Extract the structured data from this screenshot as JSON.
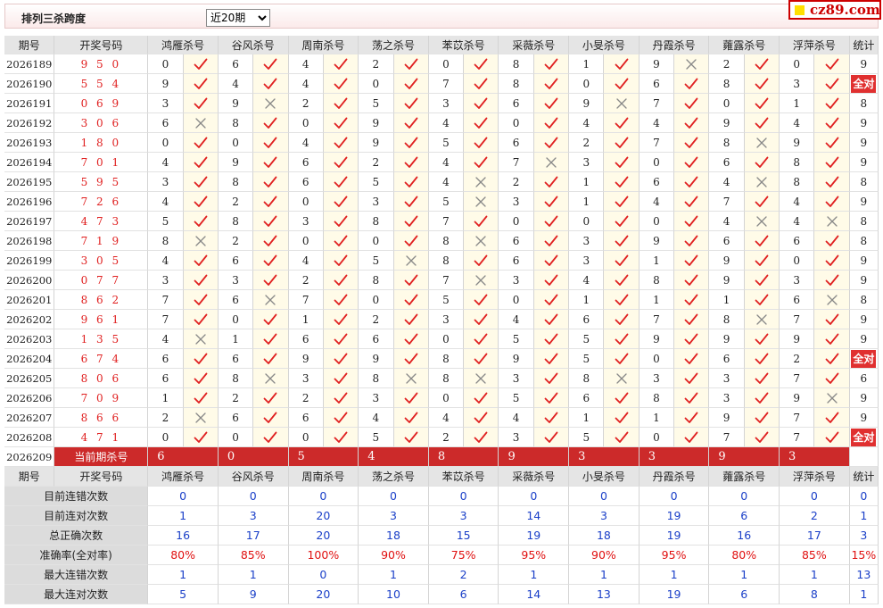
{
  "header": {
    "title": "排列三杀跨度",
    "period_select": {
      "value": "近20期",
      "options": [
        "近20期"
      ]
    },
    "logo": "cz89.com"
  },
  "columns": {
    "period": "期号",
    "win": "开奖号码",
    "experts": [
      "鸿雁杀号",
      "谷风杀号",
      "周南杀号",
      "荡之杀号",
      "苯苡杀号",
      "采薇杀号",
      "小旻杀号",
      "丹霞杀号",
      "蕹露杀号",
      "浮萍杀号"
    ],
    "stat": "统计"
  },
  "rows": [
    {
      "p": "2026189",
      "w": "9 5 0",
      "d": [
        0,
        6,
        4,
        2,
        0,
        8,
        1,
        9,
        2,
        0
      ],
      "m": [
        1,
        1,
        1,
        1,
        1,
        1,
        1,
        0,
        1,
        1
      ],
      "s": "9"
    },
    {
      "p": "2026190",
      "w": "5 5 4",
      "d": [
        9,
        4,
        4,
        0,
        7,
        8,
        0,
        6,
        8,
        3
      ],
      "m": [
        1,
        1,
        1,
        1,
        1,
        1,
        1,
        1,
        1,
        1
      ],
      "s": "全对"
    },
    {
      "p": "2026191",
      "w": "0 6 9",
      "d": [
        3,
        9,
        2,
        5,
        3,
        6,
        9,
        7,
        0,
        1
      ],
      "m": [
        1,
        0,
        1,
        1,
        1,
        1,
        0,
        1,
        1,
        1
      ],
      "s": "8"
    },
    {
      "p": "2026192",
      "w": "3 0 6",
      "d": [
        6,
        8,
        0,
        9,
        4,
        0,
        4,
        4,
        9,
        4
      ],
      "m": [
        0,
        1,
        1,
        1,
        1,
        1,
        1,
        1,
        1,
        1
      ],
      "s": "9"
    },
    {
      "p": "2026193",
      "w": "1 8 0",
      "d": [
        0,
        0,
        4,
        9,
        5,
        6,
        2,
        7,
        8,
        9
      ],
      "m": [
        1,
        1,
        1,
        1,
        1,
        1,
        1,
        1,
        0,
        1
      ],
      "s": "9"
    },
    {
      "p": "2026194",
      "w": "7 0 1",
      "d": [
        4,
        9,
        6,
        2,
        4,
        7,
        3,
        0,
        6,
        8
      ],
      "m": [
        1,
        1,
        1,
        1,
        1,
        0,
        1,
        1,
        1,
        1
      ],
      "s": "9"
    },
    {
      "p": "2026195",
      "w": "5 9 5",
      "d": [
        3,
        8,
        6,
        5,
        4,
        2,
        1,
        6,
        4,
        8
      ],
      "m": [
        1,
        1,
        1,
        1,
        0,
        1,
        1,
        1,
        0,
        1
      ],
      "s": "8"
    },
    {
      "p": "2026196",
      "w": "7 2 6",
      "d": [
        4,
        2,
        0,
        3,
        5,
        3,
        1,
        4,
        7,
        4
      ],
      "m": [
        1,
        1,
        1,
        1,
        0,
        1,
        1,
        1,
        1,
        1
      ],
      "s": "9"
    },
    {
      "p": "2026197",
      "w": "4 7 3",
      "d": [
        5,
        8,
        3,
        8,
        7,
        0,
        0,
        0,
        4,
        4
      ],
      "m": [
        1,
        1,
        1,
        1,
        1,
        1,
        1,
        1,
        0,
        0
      ],
      "s": "8"
    },
    {
      "p": "2026198",
      "w": "7 1 9",
      "d": [
        8,
        2,
        0,
        0,
        8,
        6,
        3,
        9,
        6,
        6
      ],
      "m": [
        0,
        1,
        1,
        1,
        0,
        1,
        1,
        1,
        1,
        1
      ],
      "s": "8"
    },
    {
      "p": "2026199",
      "w": "3 0 5",
      "d": [
        4,
        6,
        4,
        5,
        8,
        6,
        3,
        1,
        9,
        0
      ],
      "m": [
        1,
        1,
        1,
        0,
        1,
        1,
        1,
        1,
        1,
        1
      ],
      "s": "9"
    },
    {
      "p": "2026200",
      "w": "0 7 7",
      "d": [
        3,
        3,
        2,
        8,
        7,
        3,
        4,
        8,
        9,
        3
      ],
      "m": [
        1,
        1,
        1,
        1,
        0,
        1,
        1,
        1,
        1,
        1
      ],
      "s": "9"
    },
    {
      "p": "2026201",
      "w": "8 6 2",
      "d": [
        7,
        6,
        7,
        0,
        5,
        0,
        1,
        1,
        1,
        6
      ],
      "m": [
        1,
        0,
        1,
        1,
        1,
        1,
        1,
        1,
        1,
        0
      ],
      "s": "8"
    },
    {
      "p": "2026202",
      "w": "9 6 1",
      "d": [
        7,
        0,
        1,
        2,
        3,
        4,
        6,
        7,
        8,
        7
      ],
      "m": [
        1,
        1,
        1,
        1,
        1,
        1,
        1,
        1,
        0,
        1
      ],
      "s": "9"
    },
    {
      "p": "2026203",
      "w": "1 3 5",
      "d": [
        4,
        1,
        6,
        6,
        0,
        5,
        5,
        9,
        9,
        9
      ],
      "m": [
        0,
        1,
        1,
        1,
        1,
        1,
        1,
        1,
        1,
        1
      ],
      "s": "9"
    },
    {
      "p": "2026204",
      "w": "6 7 4",
      "d": [
        6,
        6,
        9,
        9,
        8,
        9,
        5,
        0,
        6,
        2
      ],
      "m": [
        1,
        1,
        1,
        1,
        1,
        1,
        1,
        1,
        1,
        1
      ],
      "s": "全对"
    },
    {
      "p": "2026205",
      "w": "8 0 6",
      "d": [
        6,
        8,
        3,
        8,
        8,
        3,
        8,
        3,
        3,
        7
      ],
      "m": [
        1,
        0,
        1,
        0,
        0,
        1,
        0,
        1,
        1,
        1
      ],
      "s": "6"
    },
    {
      "p": "2026206",
      "w": "7 0 9",
      "d": [
        1,
        2,
        2,
        3,
        0,
        5,
        6,
        8,
        3,
        9
      ],
      "m": [
        1,
        1,
        1,
        1,
        1,
        1,
        1,
        1,
        1,
        0
      ],
      "s": "9"
    },
    {
      "p": "2026207",
      "w": "8 6 6",
      "d": [
        2,
        6,
        6,
        4,
        4,
        4,
        1,
        1,
        9,
        7
      ],
      "m": [
        0,
        1,
        1,
        1,
        1,
        1,
        1,
        1,
        1,
        1
      ],
      "s": "9"
    },
    {
      "p": "2026208",
      "w": "4 7 1",
      "d": [
        0,
        0,
        0,
        5,
        2,
        3,
        5,
        0,
        7,
        7
      ],
      "m": [
        1,
        1,
        1,
        1,
        1,
        1,
        1,
        1,
        1,
        1
      ],
      "s": "全对"
    }
  ],
  "current": {
    "period": "2026209",
    "label": "当前期杀号",
    "kills": [
      "6",
      "0",
      "5",
      "4",
      "8",
      "9",
      "3",
      "3",
      "9",
      "3"
    ]
  },
  "stats": [
    {
      "label": "目前连错次数",
      "values": [
        "0",
        "0",
        "0",
        "0",
        "0",
        "0",
        "0",
        "0",
        "0",
        "0",
        "0"
      ]
    },
    {
      "label": "目前连对次数",
      "values": [
        "1",
        "3",
        "20",
        "3",
        "3",
        "14",
        "3",
        "19",
        "6",
        "2",
        "1"
      ]
    },
    {
      "label": "总正确次数",
      "values": [
        "16",
        "17",
        "20",
        "18",
        "15",
        "19",
        "18",
        "19",
        "16",
        "17",
        "3"
      ]
    },
    {
      "label": "准确率(全对率)",
      "values": [
        "80%",
        "85%",
        "100%",
        "90%",
        "75%",
        "95%",
        "90%",
        "95%",
        "80%",
        "85%",
        "15%"
      ],
      "pct": true
    },
    {
      "label": "最大连错次数",
      "values": [
        "1",
        "1",
        "0",
        "1",
        "2",
        "1",
        "1",
        "1",
        "1",
        "1",
        "13"
      ]
    },
    {
      "label": "最大连对次数",
      "values": [
        "5",
        "9",
        "20",
        "10",
        "6",
        "14",
        "13",
        "19",
        "6",
        "8",
        "1"
      ]
    }
  ],
  "colors": {
    "accent_red": "#cc2a2a",
    "check_red": "#e02020",
    "stat_blue": "#1a3fc8",
    "header_gray": "#e5e5e5"
  },
  "icons": {
    "correct": "check-icon",
    "wrong": "cross-icon"
  }
}
